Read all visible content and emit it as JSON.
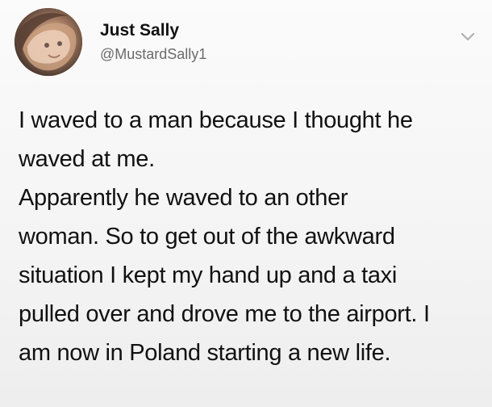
{
  "user": {
    "name": "Just Sally",
    "handle": "@MustardSally1"
  },
  "icons": {
    "avatar": "avatar-photo",
    "menu": "chevron-down-icon"
  },
  "tweet": {
    "text": "I waved to a man because I thought he\nwaved at me.\nApparently he waved to an other\nwoman. So to get out of the awkward\nsituation I kept my hand up and a taxi\npulled over and drove me to the airport. I\nam now in Poland starting a new life."
  }
}
